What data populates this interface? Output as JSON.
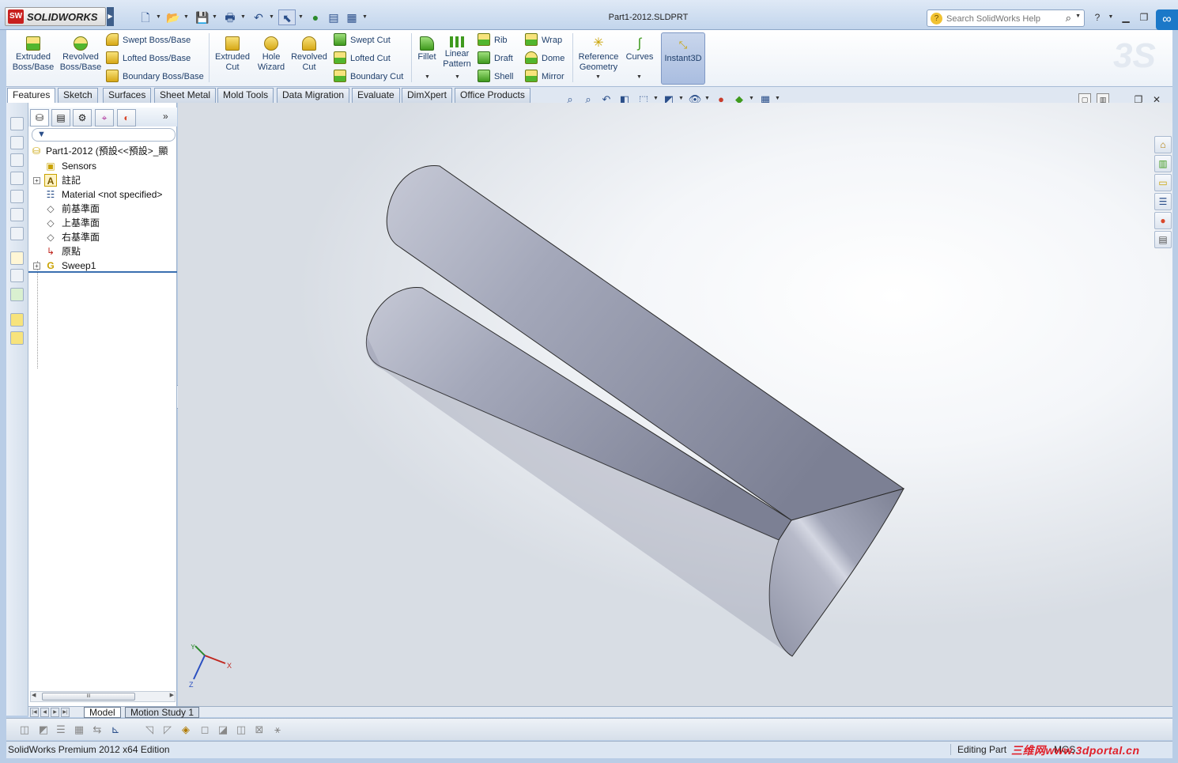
{
  "titlebar": {
    "logo_text": "SOLIDWORKS",
    "logo_badge": "SW",
    "doc_title": "Part1-2012.SLDPRT",
    "help_search_placeholder": "Search SolidWorks Help",
    "help_label": "?"
  },
  "commands": {
    "extruded_boss": "Extruded\nBoss/Base",
    "revolved_boss": "Revolved\nBoss/Base",
    "swept_boss": "Swept Boss/Base",
    "lofted_boss": "Lofted Boss/Base",
    "boundary_boss": "Boundary Boss/Base",
    "extruded_cut": "Extruded\nCut",
    "hole_wizard": "Hole\nWizard",
    "revolved_cut": "Revolved\nCut",
    "swept_cut": "Swept Cut",
    "lofted_cut": "Lofted Cut",
    "boundary_cut": "Boundary Cut",
    "fillet": "Fillet",
    "linear_pattern": "Linear\nPattern",
    "rib": "Rib",
    "draft": "Draft",
    "shell": "Shell",
    "wrap": "Wrap",
    "dome": "Dome",
    "mirror": "Mirror",
    "reference_geometry": "Reference\nGeometry",
    "curves": "Curves",
    "instant3d": "Instant3D"
  },
  "tabs": [
    "Features",
    "Sketch",
    "Surfaces",
    "Sheet Metal",
    "Mold Tools",
    "Data Migration",
    "Evaluate",
    "DimXpert",
    "Office Products"
  ],
  "feature_tree": {
    "root": "Part1-2012  (預設<<預設>_顯",
    "items": [
      {
        "label": "Sensors"
      },
      {
        "label": "註記"
      },
      {
        "label": "Material <not specified>"
      },
      {
        "label": "前基準面"
      },
      {
        "label": "上基準面"
      },
      {
        "label": "右基準面"
      },
      {
        "label": "原點"
      },
      {
        "label": "Sweep1"
      }
    ],
    "scroll_thumb": "III"
  },
  "triad": {
    "x": "X",
    "y": "Y",
    "z": "Z"
  },
  "model_tabs": {
    "model": "Model",
    "motion": "Motion Study 1"
  },
  "status": {
    "edition": "SolidWorks Premium 2012 x64 Edition",
    "mode": "Editing Part",
    "brand": "三维网www.3dportal.cn",
    "mid": "MGS"
  },
  "colors": {
    "part_body": "#9ea2b4",
    "part_dark": "#6e7286",
    "part_light": "#c3c6d4",
    "ui_blue": "#1f3f6b"
  }
}
